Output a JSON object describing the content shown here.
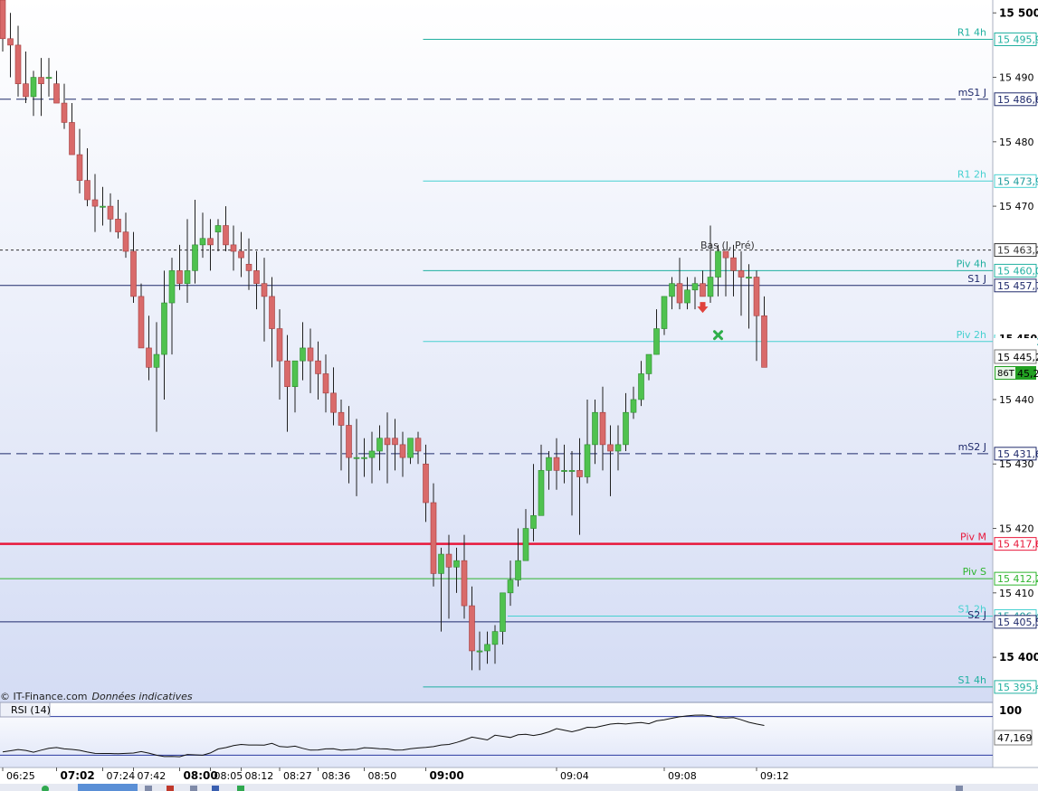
{
  "chart_data": {
    "type": "candlestick",
    "source_credit": "© IT-Finance.com",
    "source_note": "Données indicatives",
    "y_axis": {
      "ylim": [
        15393,
        15502
      ],
      "ticks": [
        15500,
        15490,
        15480,
        15470,
        15440,
        15430,
        15420,
        15410,
        15400
      ],
      "tick_labels": [
        "15 500",
        "15 490",
        "15 480",
        "15 470",
        "15 440",
        "15 430",
        "15 420",
        "15 410",
        "15 400"
      ],
      "bold_ticks": [
        15500,
        15400
      ]
    },
    "x_axis": {
      "tick_labels": [
        "06:25",
        "07:02",
        "07:24",
        "07:42",
        "08:00",
        "08:05",
        "08:12",
        "08:27",
        "08:36",
        "08:50",
        "09:00",
        "09:04",
        "09:08",
        "09:12"
      ],
      "bold_ticks": [
        "07:02",
        "08:00",
        "09:00"
      ],
      "tick_index": [
        0,
        7,
        13,
        17,
        23,
        27,
        31,
        36,
        41,
        47,
        55,
        72,
        86,
        98
      ]
    },
    "level_lines": [
      {
        "label": "R1 4h",
        "value": 15495.9,
        "value_label": "15 495,9",
        "color": "#21b0a0",
        "style": "solid",
        "start_index": 55
      },
      {
        "label": "mS1 J",
        "value": 15486.6,
        "value_label": "15 486,6",
        "color": "#1f2a6b",
        "style": "dashed",
        "start_index": 0
      },
      {
        "label": "R1 2h",
        "value": 15473.9,
        "value_label": "15 473,9",
        "color": "#47d1d1",
        "style": "solid",
        "start_index": 55
      },
      {
        "label": "",
        "value": 15463.2,
        "value_label": "15 463,2",
        "color": "#333333",
        "style": "dotted",
        "start_index": 0
      },
      {
        "label": "Piv 4h",
        "value": 15460.0,
        "value_label": "15 460,0",
        "color": "#21b0a0",
        "style": "solid",
        "start_index": 55
      },
      {
        "label": "S1 J",
        "value": 15457.7,
        "value_label": "15 457,7",
        "color": "#1f2a6b",
        "style": "solid",
        "start_index": 0
      },
      {
        "label": "Piv 2h",
        "value": 15449.0,
        "value_label": "15 449,0",
        "color": "#47d1d1",
        "style": "solid",
        "start_index": 55
      },
      {
        "label": "mS2 J",
        "value": 15431.6,
        "value_label": "15 431,6",
        "color": "#1f2a6b",
        "style": "dashed",
        "start_index": 0
      },
      {
        "label": "Piv M",
        "value": 15417.6,
        "value_label": "15 417,6",
        "color": "#e8173a",
        "style": "solid",
        "start_index": 0,
        "width": 2.5
      },
      {
        "label": "Piv S",
        "value": 15412.2,
        "value_label": "15 412,2",
        "color": "#2fb52f",
        "style": "solid",
        "start_index": 0
      },
      {
        "label": "S1 2h",
        "value": 15406.4,
        "value_label": "15 406,4",
        "color": "#47d1d1",
        "style": "solid",
        "start_index": 66
      },
      {
        "label": "S2 J",
        "value": 15405.5,
        "value_label": "15 405,5",
        "color": "#1f2a6b",
        "style": "solid",
        "start_index": 0
      },
      {
        "label": "S1 4h",
        "value": 15395.4,
        "value_label": "15 395,4",
        "color": "#21b0a0",
        "style": "solid",
        "start_index": 55
      }
    ],
    "annotations": {
      "bas_label": "Bas (J, Pré)",
      "price_box": "15 445,2",
      "last_price_tag": "86T",
      "last_price_value": "45,2",
      "partial_tick": "15 450"
    },
    "candles": {
      "o": [
        15502,
        15496,
        15495,
        15489,
        15487,
        15490,
        15490,
        15489,
        15486,
        15483,
        15478,
        15474,
        15471,
        15470,
        15470,
        15468,
        15466,
        15463,
        15456,
        15448,
        15445,
        15447,
        15455,
        15460,
        15458,
        15460,
        15464,
        15465,
        15466,
        15467,
        15464,
        15463,
        15461,
        15460,
        15458,
        15456,
        15451,
        15446,
        15442,
        15446,
        15448,
        15446,
        15444,
        15441,
        15438,
        15436,
        15431,
        15431,
        15431,
        15432,
        15434,
        15434,
        15433,
        15431,
        15434,
        15430,
        15424,
        15413,
        15416,
        15414,
        15415,
        15408,
        15401,
        15401,
        15402,
        15404,
        15410,
        15412,
        15415,
        15420,
        15422,
        15429,
        15431,
        15429,
        15429,
        15429,
        15428,
        15433,
        15438,
        15433,
        15432,
        15433,
        15438,
        15440,
        15444,
        15447,
        15451,
        15456,
        15458,
        15455,
        15457,
        15458,
        15456,
        15459,
        15463,
        15462,
        15460,
        15459,
        15459,
        15453
      ],
      "h": [
        15502,
        15500,
        15498,
        15494,
        15491,
        15493,
        15493,
        15491,
        15489,
        15486,
        15482,
        15479,
        15475,
        15473,
        15472,
        15471,
        15469,
        15466,
        15458,
        15453,
        15452,
        15460,
        15462,
        15464,
        15468,
        15471,
        15469,
        15468,
        15468,
        15470,
        15467,
        15466,
        15465,
        15463,
        15462,
        15459,
        15454,
        15450,
        15446,
        15452,
        15451,
        15449,
        15447,
        15445,
        15440,
        15439,
        15437,
        15434,
        15435,
        15436,
        15438,
        15437,
        15435,
        15434,
        15435,
        15433,
        15427,
        15417,
        15419,
        15417,
        15419,
        15411,
        15404,
        15404,
        15405,
        15408,
        15415,
        15420,
        15423,
        15430,
        15433,
        15432,
        15434,
        15433,
        15432,
        15434,
        15440,
        15440,
        15442,
        15436,
        15436,
        15441,
        15442,
        15446,
        15447,
        15454,
        15456,
        15459,
        15462,
        15459,
        15459,
        15460,
        15467,
        15464,
        15463,
        15464,
        15463,
        15461,
        15460,
        15456
      ],
      "l": [
        15494,
        15490,
        15487,
        15486,
        15484,
        15484,
        15487,
        15486,
        15482,
        15479,
        15472,
        15470,
        15466,
        15467,
        15466,
        15465,
        15462,
        15455,
        15449,
        15443,
        15435,
        15440,
        15447,
        15457,
        15455,
        15458,
        15462,
        15460,
        15463,
        15463,
        15460,
        15459,
        15457,
        15454,
        15449,
        15445,
        15440,
        15435,
        15438,
        15443,
        15441,
        15440,
        15438,
        15436,
        15429,
        15427,
        15425,
        15428,
        15427,
        15429,
        15427,
        15429,
        15428,
        15430,
        15430,
        15421,
        15411,
        15404,
        15406,
        15410,
        15406,
        15398,
        15398,
        15399,
        15399,
        15402,
        15408,
        15411,
        15415,
        15418,
        15422,
        15426,
        15426,
        15427,
        15422,
        15419,
        15427,
        15430,
        15429,
        15425,
        15429,
        15432,
        15437,
        15439,
        15443,
        15447,
        15450,
        15454,
        15454,
        15454,
        15454,
        15456,
        15455,
        15456,
        15456,
        15456,
        15453,
        15451,
        15446,
        15446
      ],
      "c": [
        15496,
        15495,
        15489,
        15487,
        15490,
        15489,
        15490,
        15486,
        15483,
        15478,
        15474,
        15471,
        15470,
        15470,
        15468,
        15466,
        15463,
        15456,
        15448,
        15445,
        15447,
        15455,
        15460,
        15458,
        15460,
        15464,
        15465,
        15464,
        15467,
        15464,
        15463,
        15462,
        15460,
        15458,
        15456,
        15451,
        15446,
        15442,
        15446,
        15448,
        15446,
        15444,
        15441,
        15438,
        15436,
        15431,
        15431,
        15431,
        15432,
        15434,
        15433,
        15433,
        15431,
        15434,
        15432,
        15424,
        15413,
        15416,
        15414,
        15415,
        15408,
        15401,
        15401,
        15402,
        15404,
        15410,
        15412,
        15415,
        15420,
        15422,
        15429,
        15431,
        15429,
        15429,
        15429,
        15428,
        15433,
        15438,
        15433,
        15432,
        15433,
        15438,
        15440,
        15444,
        15447,
        15451,
        15456,
        15458,
        15455,
        15457,
        15458,
        15456,
        15459,
        15463,
        15462,
        15460,
        15459,
        15459,
        15453,
        15445
      ]
    },
    "signals": [
      {
        "type": "sell-arrow",
        "index": 91,
        "price": 15454
      },
      {
        "type": "exit-cross",
        "index": 93,
        "price": 15450
      }
    ],
    "rsi": {
      "label": "RSI (14)",
      "level_label": "100",
      "value_label": "47,169",
      "ylim": [
        20,
        80
      ],
      "upper_band": 70,
      "lower_band": 30,
      "values": [
        33.4,
        34.5,
        35.8,
        34.9,
        33.0,
        35.2,
        37.1,
        37.9,
        36.5,
        35.9,
        35.0,
        33.2,
        31.8,
        31.7,
        31.7,
        31.4,
        31.8,
        32.2,
        33.7,
        32.1,
        29.9,
        28.5,
        28.7,
        28.3,
        30.7,
        30.3,
        29.9,
        32.3,
        36.4,
        37.8,
        39.9,
        41.1,
        40.5,
        40.5,
        40.4,
        42.2,
        38.9,
        38.4,
        39.3,
        37.1,
        35.2,
        35.4,
        36.5,
        36.7,
        35.1,
        35.7,
        35.9,
        37.7,
        37.3,
        36.7,
        36.4,
        35.3,
        35.4,
        36.7,
        37.4,
        38.0,
        38.8,
        40.5,
        41.1,
        43.2,
        45.7,
        48.7,
        47.3,
        45.8,
        50.7,
        49.5,
        48.3,
        51.1,
        51.6,
        50.4,
        51.8,
        54.1,
        57.5,
        55.9,
        54.2,
        56.2,
        58.9,
        58.6,
        60.4,
        62.2,
        62.9,
        62.3,
        63.2,
        63.8,
        62.6,
        65.6,
        66.7,
        68.3,
        69.8,
        70.7,
        71.5,
        71.6,
        70.9,
        69.1,
        68.5,
        68.9,
        66.7,
        64.1,
        62.3,
        60.8
      ]
    }
  }
}
